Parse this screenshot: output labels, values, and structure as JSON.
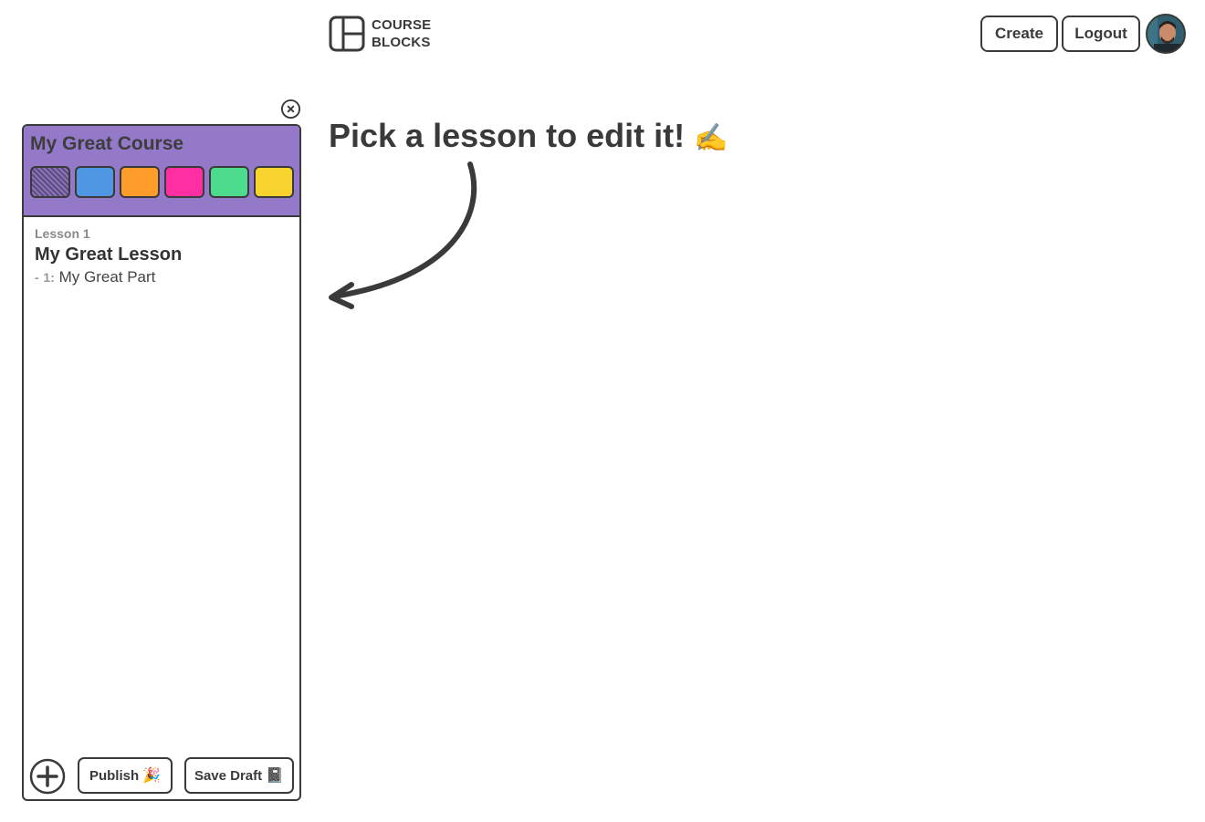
{
  "logo": {
    "line1": "COURSE",
    "line2": "BLOCKS"
  },
  "header": {
    "create_label": "Create",
    "logout_label": "Logout"
  },
  "course": {
    "title": "My Great Course",
    "colors": [
      "pattern",
      "#4f96e3",
      "#ff9d2b",
      "#ff2ea1",
      "#4ddc8d",
      "#f6d32d"
    ]
  },
  "lessons": [
    {
      "number_label": "Lesson 1",
      "title": "My Great Lesson",
      "parts": [
        {
          "dash": "-",
          "number": "1:",
          "title": "My Great Part"
        }
      ]
    }
  ],
  "actions": {
    "publish_label": "Publish",
    "publish_emoji": "🎉",
    "draft_label": "Save Draft",
    "draft_emoji": "📓"
  },
  "main": {
    "hint": "Pick a lesson to edit it!",
    "hint_emoji": "✍️"
  },
  "colors": {
    "text": "#3a3a3a",
    "panel_header": "#9479c9"
  }
}
